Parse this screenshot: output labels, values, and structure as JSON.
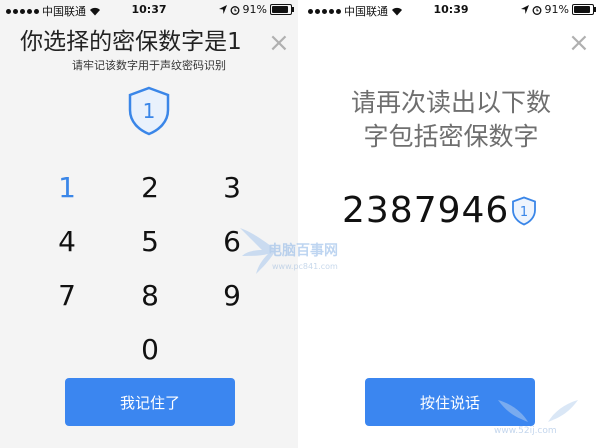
{
  "status_bar_left": {
    "carrier": "中国联通",
    "time": "10:37",
    "battery": "91%",
    "battery_level": 0.91
  },
  "status_bar_right": {
    "carrier": "中国联通",
    "time": "10:39",
    "battery": "91%",
    "battery_level": 0.91
  },
  "left_screen": {
    "title": "你选择的密保数字是1",
    "subtitle": "请牢记该数字用于声纹密码识别",
    "shield_digit": "1",
    "keys": [
      "1",
      "2",
      "3",
      "4",
      "5",
      "6",
      "7",
      "8",
      "9",
      "0"
    ],
    "active_key": "1",
    "button_label": "我记住了",
    "close_glyph": "×"
  },
  "right_screen": {
    "instruction_line1": "请再次读出以下数",
    "instruction_line2": "字包括密保数字",
    "code_digits": "2387946",
    "shield_digit": "1",
    "button_label": "按住说话",
    "close_glyph": "×"
  },
  "watermarks": {
    "text": "电脑百事网",
    "url": "www.pc841.com",
    "url2": "www.52ij.com"
  },
  "colors": {
    "accent": "#3b86f0",
    "active_digit": "#3a86e8",
    "left_background": "#f4f4f4",
    "right_background": "#ffffff"
  }
}
